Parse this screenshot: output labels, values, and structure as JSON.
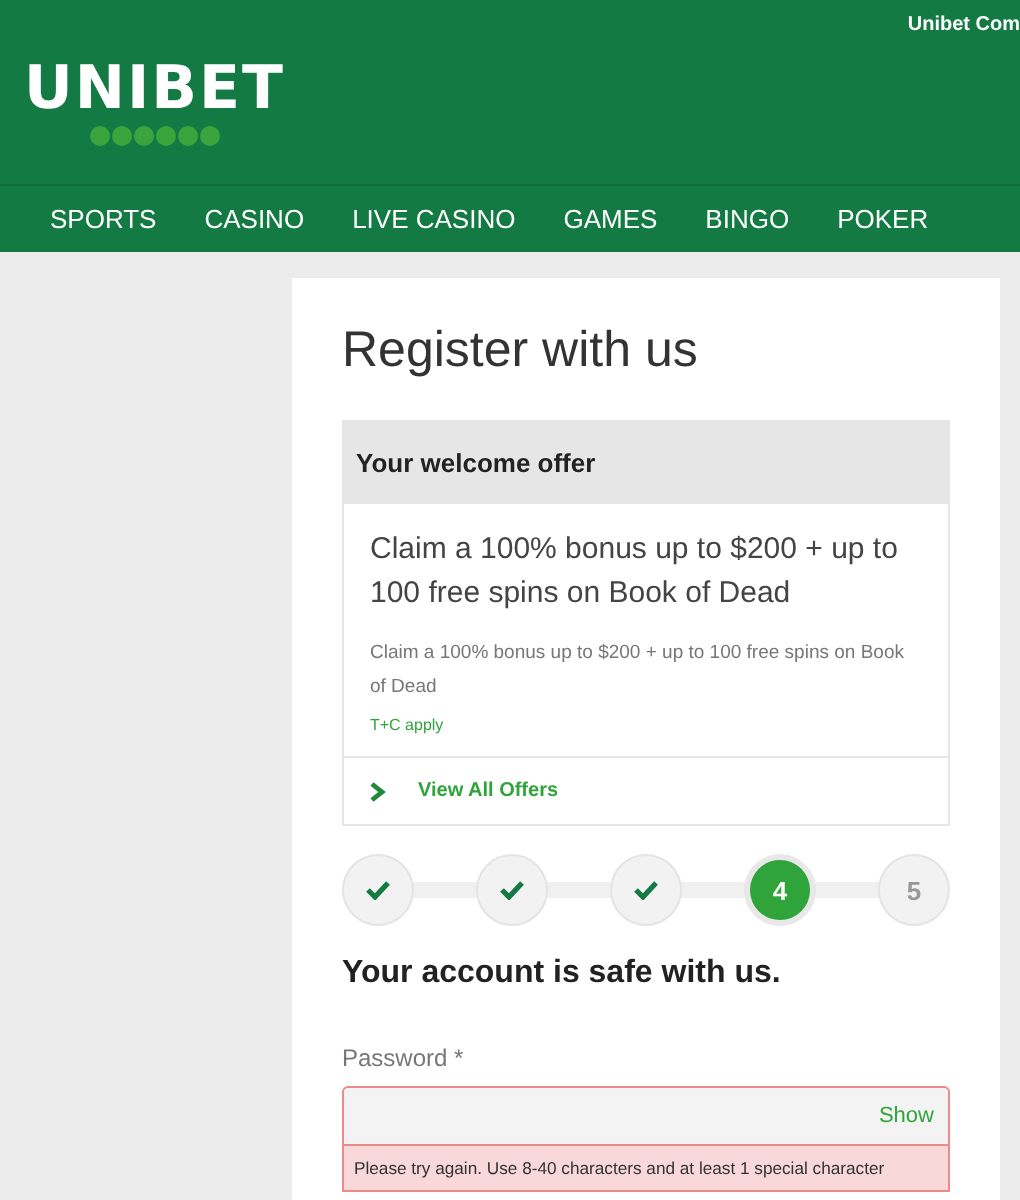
{
  "header": {
    "logo": "UNIBET",
    "top_link": "Unibet Com"
  },
  "nav": [
    {
      "label": "SPORTS"
    },
    {
      "label": "CASINO"
    },
    {
      "label": "LIVE CASINO"
    },
    {
      "label": "GAMES"
    },
    {
      "label": "BINGO"
    },
    {
      "label": "POKER"
    }
  ],
  "page": {
    "title": "Register with us",
    "offer": {
      "heading": "Your welcome offer",
      "headline": "Claim a 100% bonus up to $200 + up to 100 free spins on Book of Dead",
      "description": "Claim a 100% bonus up to $200 + up to 100 free spins on Book of Dead",
      "terms": "T+C apply",
      "link": "View All Offers"
    },
    "steps": [
      {
        "completed": true,
        "current": false
      },
      {
        "completed": true,
        "current": false
      },
      {
        "completed": true,
        "current": false
      },
      {
        "completed": false,
        "current": true,
        "label": "4"
      },
      {
        "completed": false,
        "current": false,
        "label": "5"
      }
    ],
    "section_title": "Your account is safe with us.",
    "password": {
      "label": "Password *",
      "toggle": "Show",
      "invalid": true,
      "error": "Please try again. Use 8-40 characters and at least 1 special character"
    }
  }
}
